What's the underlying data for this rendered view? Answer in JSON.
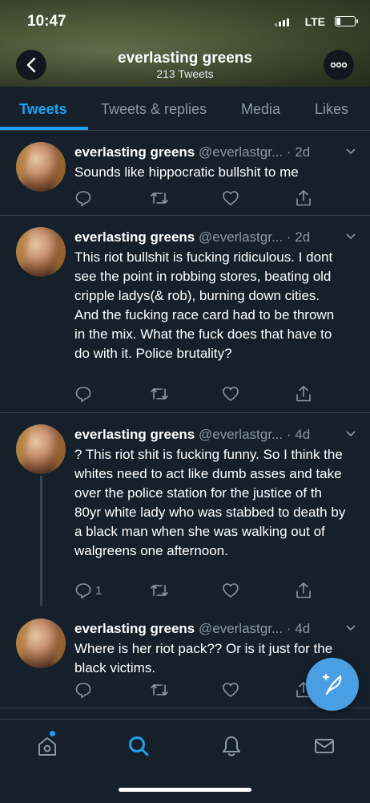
{
  "status_bar": {
    "time": "10:47",
    "network": "LTE"
  },
  "header": {
    "title": "everlasting greens",
    "subtitle": "213 Tweets"
  },
  "tabs": [
    {
      "label": "Tweets",
      "active": true
    },
    {
      "label": "Tweets & replies",
      "active": false
    },
    {
      "label": "Media",
      "active": false
    },
    {
      "label": "Likes",
      "active": false
    }
  ],
  "tweets": [
    {
      "name": "everlasting greens",
      "handle": "@everlastgr...",
      "time": "· 2d",
      "text": "Sounds like hippocratic bullshit to me",
      "reply_count": ""
    },
    {
      "name": "everlasting greens",
      "handle": "@everlastgr...",
      "time": "· 2d",
      "text": "This riot bullshit is fucking ridiculous. I dont see the point in robbing stores, beating old cripple ladys(& rob), burning down cities. And the fucking race card had to be thrown in the mix. What the fuck does that have to do with it. Police brutality?",
      "reply_count": ""
    },
    {
      "name": "everlasting greens",
      "handle": "@everlastgr...",
      "time": "· 4d",
      "text": "? This riot shit is fucking funny. So I think the whites need to act like dumb asses and take over the police station for the justice of th 80yr white lady who was stabbed to death by a black man when she was walking out of walgreens one afternoon.",
      "reply_count": "1"
    },
    {
      "name": "everlasting greens",
      "handle": "@everlastgr...",
      "time": "· 4d",
      "text": "Where is her riot pack?? Or is it just for the black victims.",
      "reply_count": ""
    }
  ],
  "icons": {
    "back": "back-arrow-icon",
    "more": "more-dots-icon",
    "reply": "reply-icon",
    "retweet": "retweet-icon",
    "like": "like-icon",
    "share": "share-icon",
    "compose": "compose-tweet-icon",
    "home": "home-icon",
    "search": "search-icon",
    "notifications": "bell-icon",
    "messages": "mail-icon"
  },
  "colors": {
    "background": "#15202b",
    "accent": "#1da1f2",
    "secondary_text": "#8899a6",
    "divider": "#38444d"
  }
}
